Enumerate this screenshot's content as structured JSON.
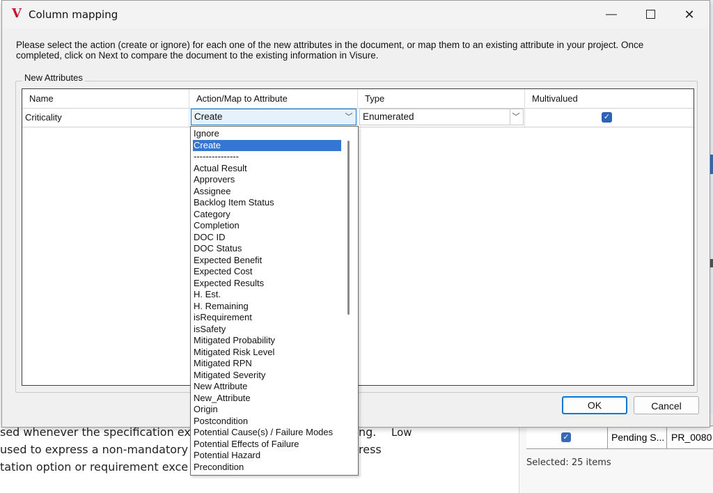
{
  "window": {
    "title": "Column mapping",
    "logo_letter": "V",
    "minimize_glyph": "—",
    "close_glyph": "✕"
  },
  "instructions": "Please select the action (create or ignore) for each one of the new attributes in the document, or map them to an existing attribute in your project. Once completed, click on Next to compare the document to the existing information in Visure.",
  "group_label": "New Attributes",
  "grid": {
    "columns": [
      "Name",
      "Action/Map to Attribute",
      "Type",
      "Multivalued"
    ],
    "rows": [
      {
        "name": "Criticality",
        "action": "Create",
        "type": "Enumerated",
        "multivalued": true
      }
    ]
  },
  "dropdown": {
    "selected": "Create",
    "options": [
      "Ignore",
      "Create",
      "---------------",
      "Actual Result",
      "Approvers",
      "Assignee",
      "Backlog Item Status",
      "Category",
      "Completion",
      "DOC ID",
      "DOC Status",
      "Expected Benefit",
      "Expected Cost",
      "Expected Results",
      "H. Est.",
      "H. Remaining",
      "isRequirement",
      "isSafety",
      "Mitigated Probability",
      "Mitigated Risk Level",
      "Mitigated RPN",
      "Mitigated Severity",
      "New Attribute",
      "New_Attribute",
      "Origin",
      "Postcondition",
      "Potential Cause(s) / Failure Modes",
      "Potential Effects of Failure",
      "Potential Hazard",
      "Precondition"
    ]
  },
  "buttons": {
    "ok": "OK",
    "cancel": "Cancel"
  },
  "background": {
    "lines": [
      "sed whenever the specification exp",
      "used to express a non-mandatory",
      "tation option or requirement exce"
    ],
    "fragment_ng": "ng.",
    "fragment_ress": "ress",
    "low": "Low",
    "table_status": "Pending S...",
    "table_id": "PR_0080",
    "selected_text": "Selected: 25 items"
  },
  "colors": {
    "accent": "#0078d7",
    "selection": "#3476d2",
    "logo": "#c8102e"
  }
}
